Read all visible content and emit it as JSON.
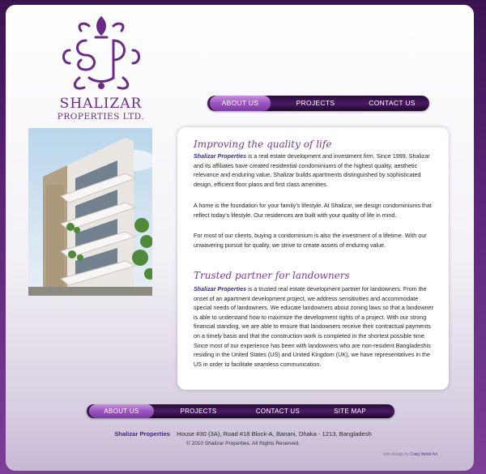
{
  "brand": {
    "name": "SHALIZAR",
    "subtitle": "PROPERTIES LTD.",
    "color": "#6a2a86"
  },
  "nav_top": {
    "items": [
      {
        "label": "ABOUT US",
        "active": true
      },
      {
        "label": "PROJECTS",
        "active": false
      },
      {
        "label": "CONTACT US",
        "active": false
      }
    ]
  },
  "photo": {
    "icon": "building-photo"
  },
  "content": {
    "sections": [
      {
        "heading": "Improving the quality of life",
        "paragraphs": [
          {
            "brand": "Shalizar Properties",
            "text": " is a real estate development and investment firm. Since 1999, Shalizar and its affiliates have created residential condominiums of the highest quality, aesthetic relevance and enduring value. Shalizar builds apartments distinguished by sophisticated design, efficient floor plans and first class amenities."
          },
          {
            "brand": "",
            "text": "A home is the foundation for your family’s lifestyle. At Shalizar, we design condominiums that reflect today’s lifestyle. Our residences are built with your quality of life in mind."
          },
          {
            "brand": "",
            "text": "For most of our clients, buying a condominium is also the investment of a lifetime. With our unwavering pursuit for quality, we strive to create assets of enduring value."
          }
        ]
      },
      {
        "heading": "Trusted partner for landowners",
        "paragraphs": [
          {
            "brand": "Shalizar Properties",
            "text": " is a trusted real estate development partner for landowners. From the onset of an apartment development project, we address sensitivities and accommodate special needs of landowners. We educate landowners about zoning laws so that a landowner is able to understand how to maximize the development rights of a project. With our strong financial standing, we are able to ensure that landowners receive their contractual payments on a timely basis and that the construction work is completed in the shortest possible time. Since most of our experience has been with landowners who are non-resident Bangladeshis residing in the United States (US) and United Kingdom (UK), we have representatives in the US in order to facilitate seamless communication."
          }
        ]
      }
    ]
  },
  "nav_bottom": {
    "items": [
      {
        "label": "ABOUT US",
        "active": true
      },
      {
        "label": "PROJECTS",
        "active": false
      },
      {
        "label": "CONTACT US",
        "active": false
      },
      {
        "label": "SITE MAP",
        "active": false
      }
    ]
  },
  "footer": {
    "brand": "Shalizar Properties",
    "address": "House #30 (3A), Road #18 Block-A, Banani, Dhaka - 1213, Bangladesh",
    "copyright": "© 2010 Shalizar Properties.  All Rights Reserved.",
    "credit_prefix": "web design by",
    "credit_link": "Craig Webb Art"
  },
  "colors": {
    "accent": "#7a3a9c",
    "nav_dark": "#2a0a3a",
    "background": "#5a2478"
  }
}
